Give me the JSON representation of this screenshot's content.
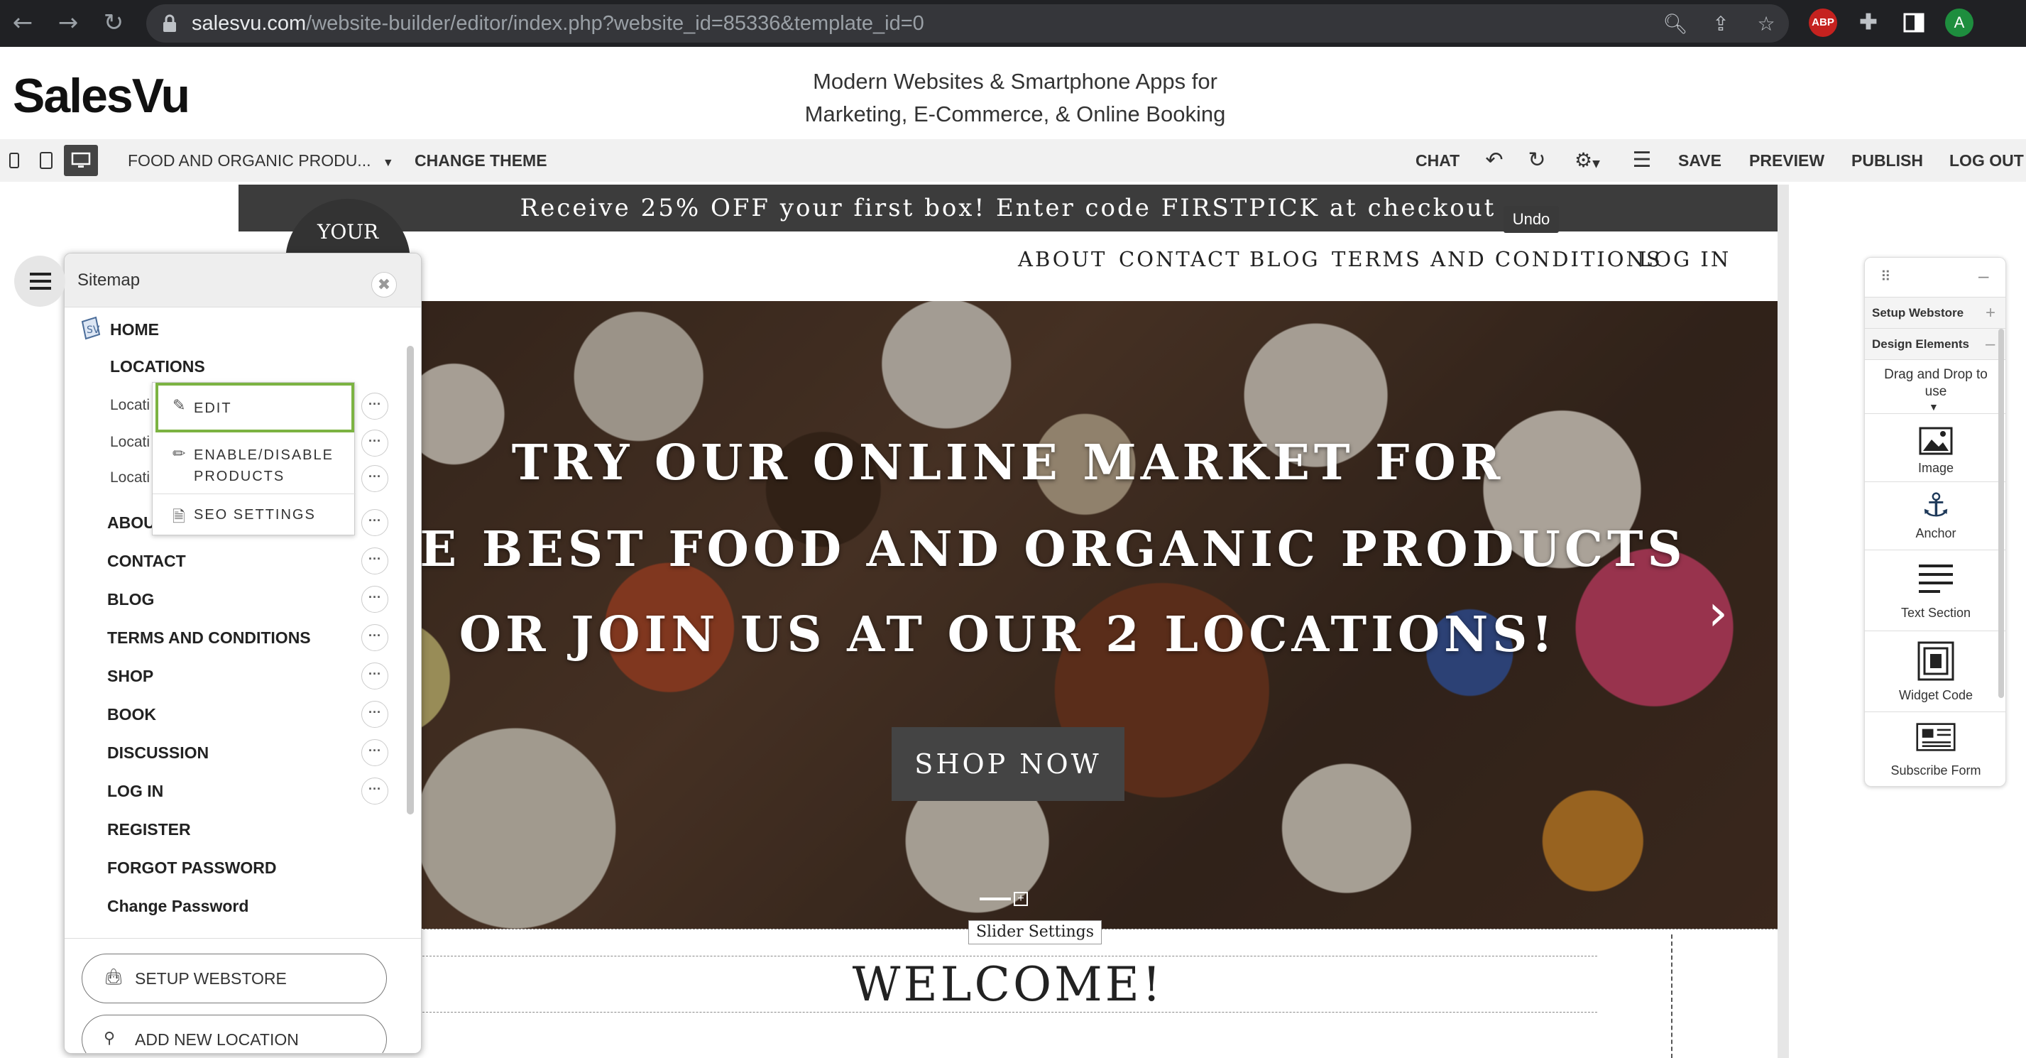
{
  "browser": {
    "url_host": "salesvu.com",
    "url_path": "/website-builder/editor/index.php?website_id=85336&template_id=0",
    "abp_label": "ABP",
    "profile_initial": "A"
  },
  "app": {
    "logo": "SalesVu",
    "tagline_line1": "Modern Websites & Smartphone Apps for",
    "tagline_line2": "Marketing, E-Commerce, & Online Booking"
  },
  "toolbar": {
    "theme_select": "FOOD AND ORGANIC PRODU...",
    "change_theme": "CHANGE THEME",
    "chat": "CHAT",
    "save": "SAVE",
    "preview": "PREVIEW",
    "publish": "PUBLISH",
    "logout": "LOG OUT",
    "undo_tooltip": "Undo"
  },
  "site": {
    "promo": "Receive 25% OFF your first box! Enter code FIRSTPICK at checkout",
    "logo_text": "YOUR",
    "nav": [
      "ABOUT",
      "CONTACT",
      "BLOG",
      "TERMS AND CONDITIONS",
      "LOG IN"
    ],
    "hero_line1": "TRY OUR ONLINE MARKET FOR",
    "hero_line2": "THE BEST FOOD AND ORGANIC PRODUCTS",
    "hero_line3": "OR JOIN US AT OUR 2 LOCATIONS!",
    "shop_now": "SHOP NOW",
    "slider_settings": "Slider Settings",
    "welcome": "WELCOME!"
  },
  "sitemap": {
    "title": "Sitemap",
    "home": "HOME",
    "locations": "LOCATIONS",
    "location_sub": [
      "Locati",
      "Locati",
      "Locati"
    ],
    "items": [
      "ABOUT",
      "CONTACT",
      "BLOG",
      "TERMS AND CONDITIONS",
      "SHOP",
      "BOOK",
      "DISCUSSION",
      "LOG IN",
      "REGISTER",
      "FORGOT PASSWORD",
      "Change Password"
    ],
    "context_menu": {
      "edit": "EDIT",
      "enable_line1": "ENABLE/DISABLE",
      "enable_line2": "PRODUCTS",
      "seo": "SEO SETTINGS"
    },
    "setup_webstore": "SETUP WEBSTORE",
    "add_location": "ADD NEW LOCATION"
  },
  "design_panel": {
    "setup_webstore": "Setup Webstore",
    "design_elements": "Design Elements",
    "hint_line1": "Drag and Drop to",
    "hint_line2": "use",
    "elements": [
      "Image",
      "Anchor",
      "Text Section",
      "Widget Code",
      "Subscribe Form"
    ]
  }
}
